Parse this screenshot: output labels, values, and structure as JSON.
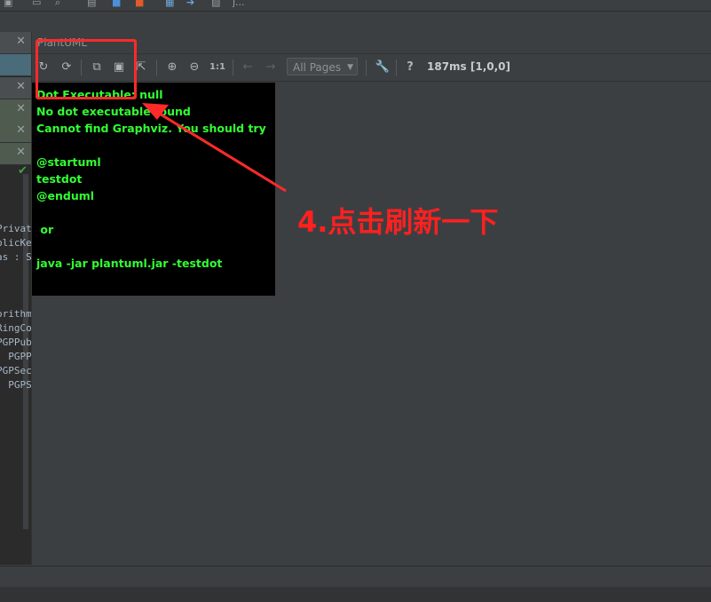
{
  "topbar": {
    "tail_text": "j..."
  },
  "plantuml": {
    "panel_title": "PlantUML",
    "pages_select": "All Pages",
    "timing": "187ms [1,0,0]",
    "zoom_label": "1:1",
    "help": "?"
  },
  "output_lines": [
    "Dot Executable: null",
    "No dot executable found",
    "Cannot find Graphviz. You should try",
    "",
    "@startuml",
    "testdot",
    "@enduml",
    "",
    " or",
    "",
    "java -jar plantuml.jar -testdot"
  ],
  "left_code": [
    "Privat",
    "blicKe",
    "as : S",
    "",
    "",
    "",
    "orithm",
    "RingCo",
    "PGPPub",
    ": PGPP",
    "PGPSec",
    ": PGPS"
  ],
  "annotation": {
    "text": "4.点击刷新一下",
    "color": "#ff2020"
  },
  "colors": {
    "output_text": "#33ff33",
    "output_bg": "#000000",
    "annotation": "#ff2a2a"
  }
}
